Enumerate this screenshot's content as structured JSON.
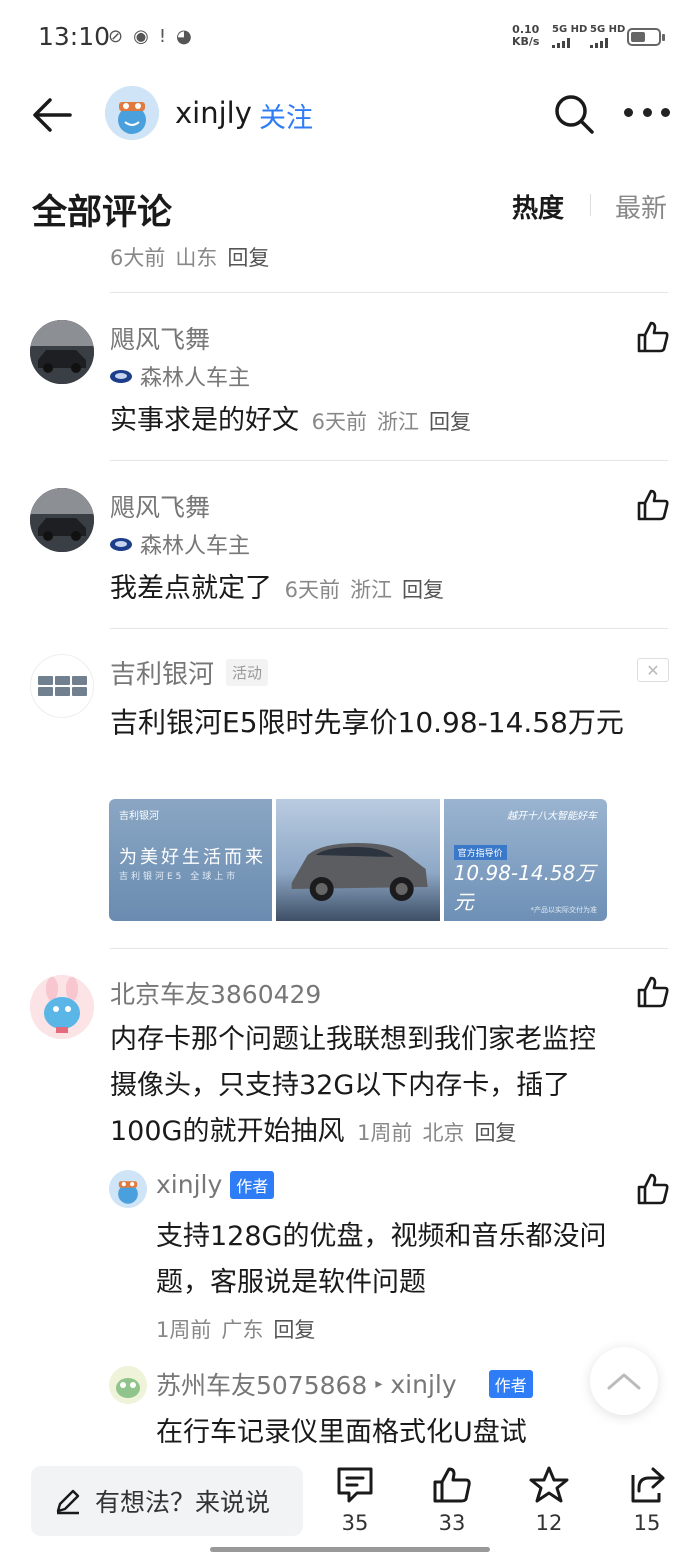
{
  "status_bar": {
    "time": "13:10",
    "net_speed_value": "0.10",
    "net_speed_unit": "KB/s",
    "sim1": "5G HD",
    "sim2": "5G HD"
  },
  "header": {
    "username": "xinjly",
    "follow_label": "关注"
  },
  "comments_header": {
    "title": "全部评论",
    "sort_hot": "热度",
    "sort_new": "最新"
  },
  "truncated_meta": {
    "time": "6大前",
    "location": "山东",
    "reply": "回复"
  },
  "comments": [
    {
      "name": "飓风飞舞",
      "badge": "森林人车主",
      "text": "实事求是的好文",
      "time": "6天前",
      "location": "浙江",
      "reply": "回复"
    },
    {
      "name": "飓风飞舞",
      "badge": "森林人车主",
      "text": "我差点就定了",
      "time": "6天前",
      "location": "浙江",
      "reply": "回复"
    }
  ],
  "ad": {
    "name": "吉利银河",
    "tag": "活动",
    "title": "吉利银河E5限时先享价10.98-14.58万元",
    "img1_brand": "吉利银河",
    "img1_slogan": "为美好生活而来",
    "img1_sub": "吉利银河E5 全球上市",
    "img3_tagline": "越开十八大智能好车",
    "img3_pricetag": "官方指导价",
    "img3_price": "10.98-14.58万元",
    "img3_note": "*产品以实际交付为准"
  },
  "comment3": {
    "name": "北京车友3860429",
    "text": "内存卡那个问题让我联想到我们家老监控摄像头，只支持32G以下内存卡，插了100G的就开始抽风",
    "time": "1周前",
    "location": "北京",
    "reply": "回复"
  },
  "replies": [
    {
      "name": "xinjly",
      "author_tag": "作者",
      "text": "支持128G的优盘，视频和音乐都没问题，客服说是软件问题",
      "time": "1周前",
      "location": "广东",
      "reply": "回复"
    },
    {
      "name": "苏州车友5075868",
      "reply_to": "xinjly",
      "author_tag": "作者",
      "text": "在行车记录仪里面格式化U盘试"
    }
  ],
  "bottom_bar": {
    "input_placeholder": "有想法？来说说",
    "comment_count": "35",
    "like_count": "33",
    "favorite_count": "12",
    "share_count": "15"
  }
}
